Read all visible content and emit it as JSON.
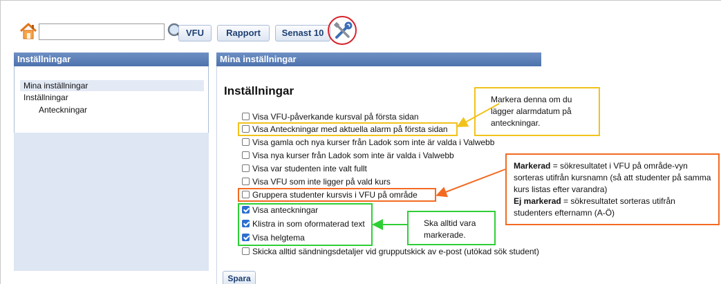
{
  "toolbar": {
    "search_value": "",
    "buttons": [
      "VFU",
      "Rapport",
      "Senast 10"
    ],
    "icons": [
      "home-icon",
      "search-icon",
      "tools-icon"
    ]
  },
  "left_panel": {
    "header": "Inställningar",
    "nav": [
      "Mina inställningar",
      "Inställningar",
      "Anteckningar"
    ]
  },
  "right_panel": {
    "header": "Mina inställningar",
    "title": "Inställningar",
    "options": [
      {
        "label": "Visa VFU-påverkande kursval på första sidan",
        "checked": false
      },
      {
        "label": "Visa Anteckningar med aktuella alarm på första sidan",
        "checked": false
      },
      {
        "label": "Visa gamla och nya kurser från Ladok som inte är valda i Valwebb",
        "checked": false
      },
      {
        "label": "Visa nya kurser från Ladok som inte är valda i Valwebb",
        "checked": false
      },
      {
        "label": "Visa var studenten inte valt fullt",
        "checked": false
      },
      {
        "label": "Visa VFU som inte ligger på vald kurs",
        "checked": false
      },
      {
        "label": "Gruppera studenter kursvis i VFU på område",
        "checked": false
      },
      {
        "label": "Visa anteckningar",
        "checked": true
      },
      {
        "label": "Klistra in som oformaterad text",
        "checked": true
      },
      {
        "label": "Visa helgtema",
        "checked": true
      },
      {
        "label": "Skicka alltid sändningsdetaljer vid grupputskick av e-post (utökad sök student)",
        "checked": false
      }
    ],
    "save_label": "Spara"
  },
  "annotations": {
    "yellow": {
      "text": "Markera denna om du lägger alarmdatum på anteckningar.",
      "color": "#f2c21b"
    },
    "orange": {
      "marked_label": "Markerad",
      "marked_text": " = sökresultatet i VFU på område-vyn sorteras utifrån kursnamn (så att studenter på samma kurs listas efter varandra)",
      "unmarked_label": "Ej markerad",
      "unmarked_text": " = sökresultatet sorteras utifrån studenters efternamn (A-Ö)",
      "color": "#f26a21"
    },
    "green": {
      "text": "Ska alltid vara markerade.",
      "color": "#2ecf35"
    },
    "tools_circle_color": "#d6222a"
  }
}
